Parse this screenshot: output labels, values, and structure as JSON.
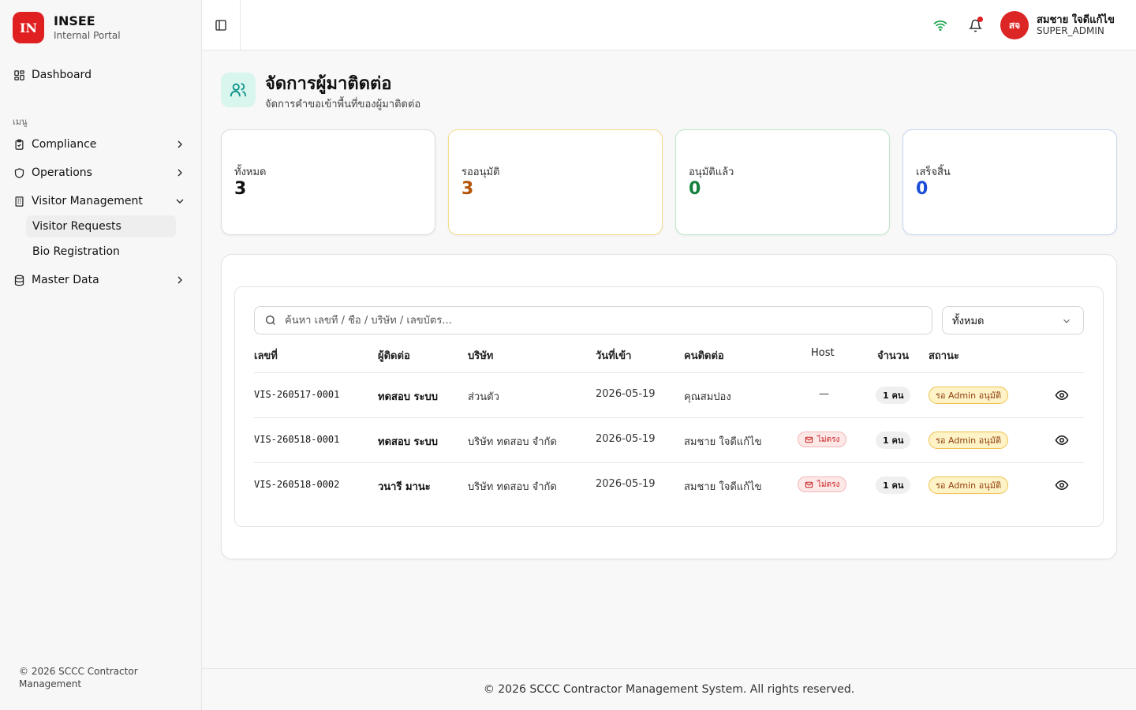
{
  "brand": {
    "logo": "IN",
    "name": "INSEE",
    "subtitle": "Internal Portal"
  },
  "sidebar": {
    "dashboard": "Dashboard",
    "section_label": "เมนู",
    "items": [
      {
        "label": "Compliance",
        "icon": "clipboard-check-icon"
      },
      {
        "label": "Operations",
        "icon": "shield-icon"
      },
      {
        "label": "Visitor Management",
        "icon": "building-icon"
      },
      {
        "label": "Master Data",
        "icon": "database-icon"
      }
    ],
    "sub_items": [
      {
        "label": "Visitor Requests",
        "active": true
      },
      {
        "label": "Bio Registration",
        "active": false
      }
    ],
    "footer": "© 2026 SCCC Contractor Management"
  },
  "header": {
    "avatar_initials": "สจ",
    "user_name": "สมชาย ใจดีแก้ไข",
    "user_role": "SUPER_ADMIN",
    "notification_indicator": true
  },
  "page": {
    "title": "จัดการผู้มาติดต่อ",
    "subtitle": "จัดการคำขอเข้าพื้นที่ของผู้มาติดต่อ"
  },
  "stats": [
    {
      "label": "ทั้งหมด",
      "value": "3",
      "color": "#111111",
      "border": "#dddddd"
    },
    {
      "label": "รออนุมัติ",
      "value": "3",
      "color": "#b45309",
      "border": "#f5dc8a"
    },
    {
      "label": "อนุมัติแล้ว",
      "value": "0",
      "color": "#15803d",
      "border": "#bfe8cc"
    },
    {
      "label": "เสร็จสิ้น",
      "value": "0",
      "color": "#1d4ed8",
      "border": "#c4d7f2"
    }
  ],
  "table": {
    "search_placeholder": "ค้นหา เลขที่ / ชื่อ / บริษัท / เลขบัตร...",
    "filter_value": "ทั้งหมด",
    "columns": [
      "เลขที่",
      "ผู้ติดต่อ",
      "บริษัท",
      "วันที่เข้า",
      "คนติดต่อ",
      "Host",
      "จำนวน",
      "สถานะ"
    ],
    "rows": [
      {
        "id": "VIS-260517-0001",
        "contact": "ทดสอบ ระบบ",
        "company": "ส่วนตัว",
        "date": "2026-05-19",
        "host_contact": "คุณสมปอง",
        "host": "—",
        "host_badge": false,
        "count": "1 คน",
        "status": "รอ Admin อนุมัติ"
      },
      {
        "id": "VIS-260518-0001",
        "contact": "ทดสอบ ระบบ",
        "company": "บริษัท ทดสอบ จำกัด",
        "date": "2026-05-19",
        "host_contact": "สมชาย ใจดีแก้ไข",
        "host": "ไม่ตรง",
        "host_badge": true,
        "count": "1 คน",
        "status": "รอ Admin อนุมัติ"
      },
      {
        "id": "VIS-260518-0002",
        "contact": "วนารี มานะ",
        "company": "บริษัท ทดสอบ จำกัด",
        "date": "2026-05-19",
        "host_contact": "สมชาย ใจดีแก้ไข",
        "host": "ไม่ตรง",
        "host_badge": true,
        "count": "1 คน",
        "status": "รอ Admin อนุมัติ"
      }
    ]
  },
  "footer": "© 2026 SCCC Contractor Management System. All rights reserved."
}
